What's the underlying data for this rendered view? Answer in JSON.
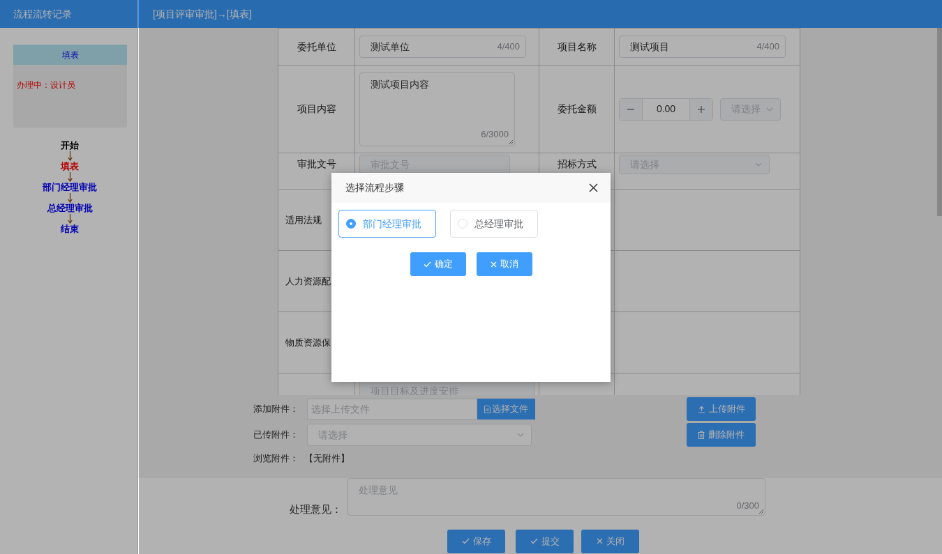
{
  "sidebar": {
    "title": "流程流转记录",
    "current_step": {
      "title": "填表",
      "status": "办理中：设计员"
    },
    "flow": [
      {
        "label": "开始",
        "color": "#000000"
      },
      {
        "label": "填表",
        "color": "#b30000"
      },
      {
        "label": "部门经理审批",
        "color": "#0000b3"
      },
      {
        "label": "总经理审批",
        "color": "#0000b3"
      },
      {
        "label": "结束",
        "color": "#0000b3"
      }
    ]
  },
  "header": {
    "title": "[项目评审审批]→[填表]"
  },
  "form": {
    "rows": [
      {
        "cells": [
          {
            "label": "委托单位",
            "field": {
              "kind": "input",
              "value": "测试单位",
              "counter": "4/400"
            }
          },
          {
            "label": "项目名称",
            "field": {
              "kind": "input",
              "value": "测试项目",
              "counter": "4/400"
            }
          }
        ]
      },
      {
        "cells": [
          {
            "label": "项目内容",
            "field": {
              "kind": "textarea",
              "value": "测试项目内容",
              "counter": "6/3000"
            }
          },
          {
            "label": "委托金额",
            "field": {
              "kind": "amount",
              "value": "0.00",
              "unit_placeholder": "请选择"
            }
          }
        ]
      },
      {
        "cells": [
          {
            "label": "审批文号",
            "field": {
              "kind": "input",
              "placeholder": "审批文号"
            }
          },
          {
            "label": "招标方式",
            "field": {
              "kind": "select",
              "placeholder": "请选择"
            }
          }
        ]
      },
      {
        "cells": [
          {
            "label": "适用法规"
          }
        ]
      },
      {
        "cells": [
          {
            "label": "人力资源配"
          }
        ]
      },
      {
        "cells": [
          {
            "label": "物质资源保"
          }
        ]
      },
      {
        "cells": [
          {
            "field": {
              "kind": "input",
              "placeholder": "项目目标及进度安排"
            }
          }
        ]
      }
    ]
  },
  "attachments": {
    "add": {
      "label": "添加附件：",
      "placeholder": "选择上传文件",
      "button": "选择文件"
    },
    "uploaded": {
      "label": "已传附件：",
      "placeholder": "请选择"
    },
    "browse": {
      "label": "浏览附件：",
      "value": "【无附件】"
    },
    "buttons": [
      {
        "label": "上传附件",
        "kind": "upload"
      },
      {
        "label": "删除附件",
        "kind": "delete"
      }
    ]
  },
  "opinion": {
    "label": "处理意见：",
    "placeholder": "处理意见",
    "counter": "0/300"
  },
  "buttons": [
    {
      "label": "保存",
      "kind": "check"
    },
    {
      "label": "提交",
      "kind": "check"
    },
    {
      "label": "关闭",
      "kind": "close"
    }
  ],
  "modal": {
    "title": "选择流程步骤",
    "options": [
      {
        "label": "部门经理审批",
        "selected": true
      },
      {
        "label": "总经理审批",
        "selected": false
      }
    ],
    "buttons": [
      {
        "label": "确定",
        "kind": "check"
      },
      {
        "label": "取消",
        "kind": "close"
      }
    ]
  }
}
